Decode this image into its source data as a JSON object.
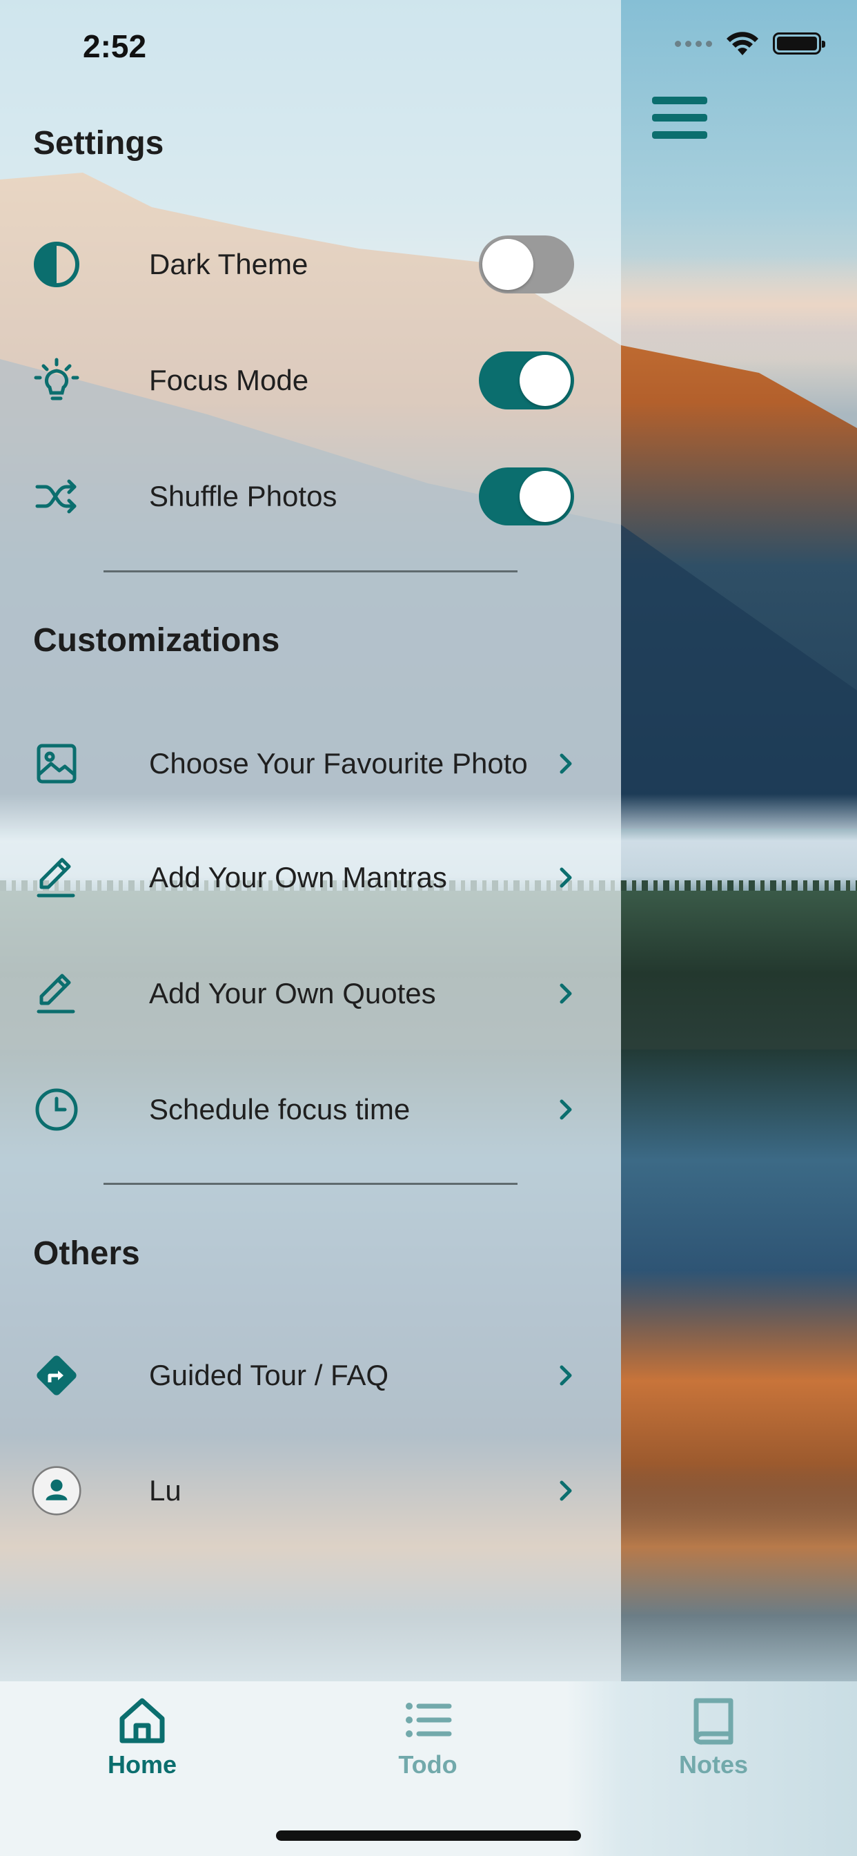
{
  "status_bar": {
    "time": "2:52"
  },
  "colors": {
    "accent": "#0b6e6e",
    "tab_inactive": "#72a9ab"
  },
  "sections": [
    {
      "title": "Settings",
      "items": [
        {
          "label": "Dark Theme",
          "icon": "contrast-icon",
          "control": "toggle",
          "value": false
        },
        {
          "label": "Focus Mode",
          "icon": "lightbulb-icon",
          "control": "toggle",
          "value": true
        },
        {
          "label": "Shuffle Photos",
          "icon": "shuffle-icon",
          "control": "toggle",
          "value": true
        }
      ]
    },
    {
      "title": "Customizations",
      "items": [
        {
          "label": "Choose Your Favourite Photo",
          "icon": "image-icon",
          "control": "chevron"
        },
        {
          "label": "Add Your Own Mantras",
          "icon": "pencil-icon",
          "control": "chevron"
        },
        {
          "label": "Add Your Own Quotes",
          "icon": "pencil-icon",
          "control": "chevron"
        },
        {
          "label": "Schedule focus time",
          "icon": "clock-icon",
          "control": "chevron"
        }
      ]
    },
    {
      "title": "Others",
      "items": [
        {
          "label": "Guided Tour / FAQ",
          "icon": "directions-icon",
          "control": "chevron"
        },
        {
          "label": "Lu",
          "icon": "avatar-icon",
          "control": "chevron"
        }
      ]
    }
  ],
  "tabs": [
    {
      "label": "Home",
      "icon": "home-icon",
      "active": true
    },
    {
      "label": "Todo",
      "icon": "list-icon",
      "active": false
    },
    {
      "label": "Notes",
      "icon": "book-icon",
      "active": false
    }
  ]
}
